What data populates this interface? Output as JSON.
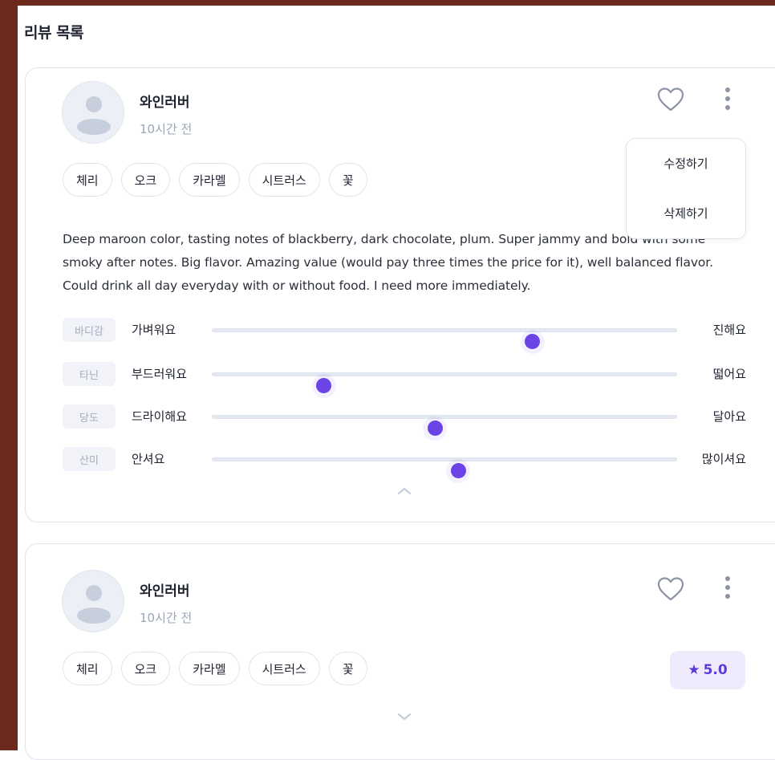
{
  "section_title": "리뷰 목록",
  "reviews": [
    {
      "user": "와인러버",
      "time": "10시간 전",
      "tags": [
        "체리",
        "오크",
        "카라멜",
        "시트러스",
        "꽃"
      ],
      "text": "Deep maroon color, tasting notes of blackberry, dark chocolate, plum. Super jammy and bold with some smoky after notes. Big flavor. Amazing value (would pay three times the price for it), well balanced flavor. Could drink all day everyday with or without food. I need more immediately.",
      "menu": {
        "edit": "수정하기",
        "delete": "삭제하기"
      },
      "profile": [
        {
          "chip": "바디감",
          "left": "가벼워요",
          "right": "진해요",
          "level": 0.69
        },
        {
          "chip": "타닌",
          "left": "부드러워요",
          "right": "떫어요",
          "level": 0.24
        },
        {
          "chip": "당도",
          "left": "드라이해요",
          "right": "달아요",
          "level": 0.48
        },
        {
          "chip": "산미",
          "left": "안셔요",
          "right": "많이셔요",
          "level": 0.53
        }
      ]
    },
    {
      "user": "와인러버",
      "time": "10시간 전",
      "tags": [
        "체리",
        "오크",
        "카라멜",
        "시트러스",
        "꽃"
      ],
      "rating": "5.0"
    }
  ],
  "colors": {
    "accent": "#6b43e6",
    "frame": "#6b2a1b",
    "rating_bg": "#efebfd"
  },
  "icons": [
    "heart-icon",
    "more-vertical-icon",
    "chevron-up-icon",
    "chevron-down-icon",
    "star-icon",
    "user-avatar-icon"
  ]
}
